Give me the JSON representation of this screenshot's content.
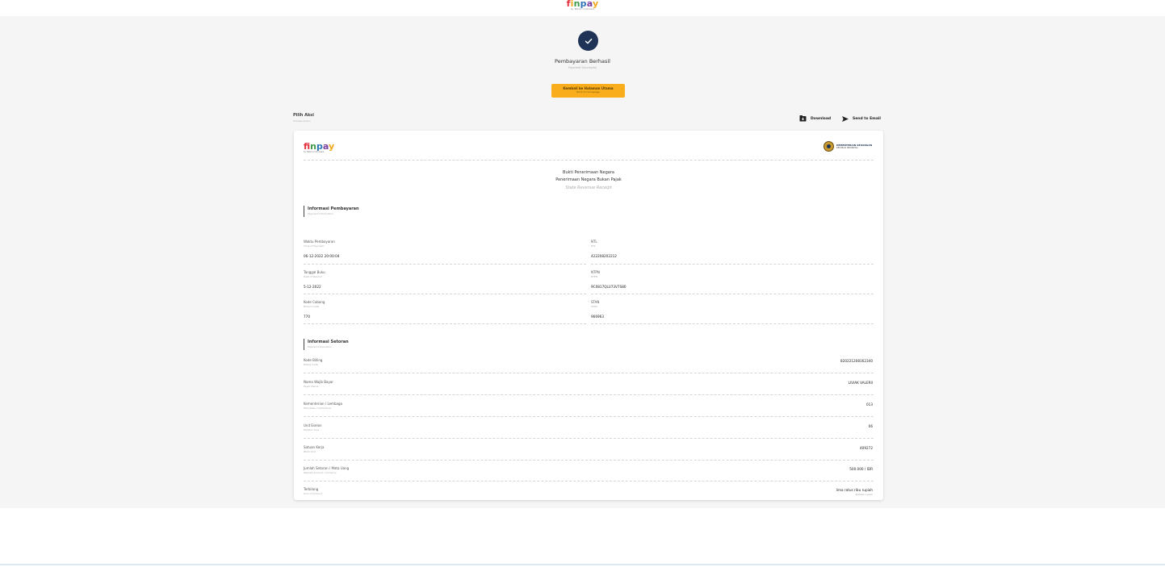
{
  "header": {
    "logo_letters": [
      "f",
      "i",
      "n",
      "p",
      "a",
      "y"
    ],
    "logo_tagline": "by Telkom Indonesia"
  },
  "status": {
    "icon": "check-icon",
    "title": "Pembayaran Berhasil",
    "subtitle": "Payment Successful",
    "color": "#1e3356"
  },
  "home_button": {
    "label": "Kembali ke Halaman Utama",
    "sublabel": "Back to Homepage",
    "color": "#f9ad1c"
  },
  "actions": {
    "title": "Pilih Aksi",
    "subtitle": "Choose Action",
    "download_label": "Download",
    "email_label": "Send to Email"
  },
  "receipt": {
    "ministry_name": "KEMENTERIAN KEUANGAN",
    "ministry_sub": "REPUBLIK INDONESIA",
    "title1": "Bukti Penerimaan Negara",
    "title2": "Penerimaan Negara Bukan Pajak",
    "title_en": "State Revenue Receipt",
    "payment_section": {
      "title": "Informasi Pembayaran",
      "subtitle": "Payment Information",
      "fields": [
        {
          "label": "Waktu Pembayaran",
          "sub": "Time of Payment",
          "value": "06-12-2022 20:00:04"
        },
        {
          "label": "NTL",
          "sub": "NTL",
          "value": "422208202212"
        },
        {
          "label": "Tanggal Buku",
          "sub": "Date of Record",
          "value": "5-12-2022"
        },
        {
          "label": "NTPN",
          "sub": "NTPN",
          "value": "9C0817QLU73V7S80"
        },
        {
          "label": "Kode Cabang",
          "sub": "Branch Code",
          "value": "770"
        },
        {
          "label": "STAN",
          "sub": "STAN",
          "value": "966963"
        }
      ]
    },
    "deposit_section": {
      "title": "Informasi Setoran",
      "subtitle": "Deposit Information",
      "rows": [
        {
          "label": "Kode Billing",
          "sub": "Billing Code",
          "value": "820221208162340"
        },
        {
          "label": "Nama Wajib Bayar",
          "sub": "Payer Name",
          "value": "LIVIAK VALERII"
        },
        {
          "label": "Kementerian / Lembaga",
          "sub": "Ministries / Institutions",
          "value": "013"
        },
        {
          "label": "Unit Eselon",
          "sub": "Echelon Unit",
          "value": "06"
        },
        {
          "label": "Satuan Kerja",
          "sub": "Work Unit",
          "value": "409272"
        },
        {
          "label": "Jumlah Setoran / Mata Uang",
          "sub": "Deposit Amount / Currency",
          "value": "500.000 / IDR"
        },
        {
          "label": "Terbilang",
          "sub": "Sum of Amount",
          "value": "lima ratus ribu rupiah",
          "value_sub": "Spelled rupiah"
        }
      ]
    }
  }
}
